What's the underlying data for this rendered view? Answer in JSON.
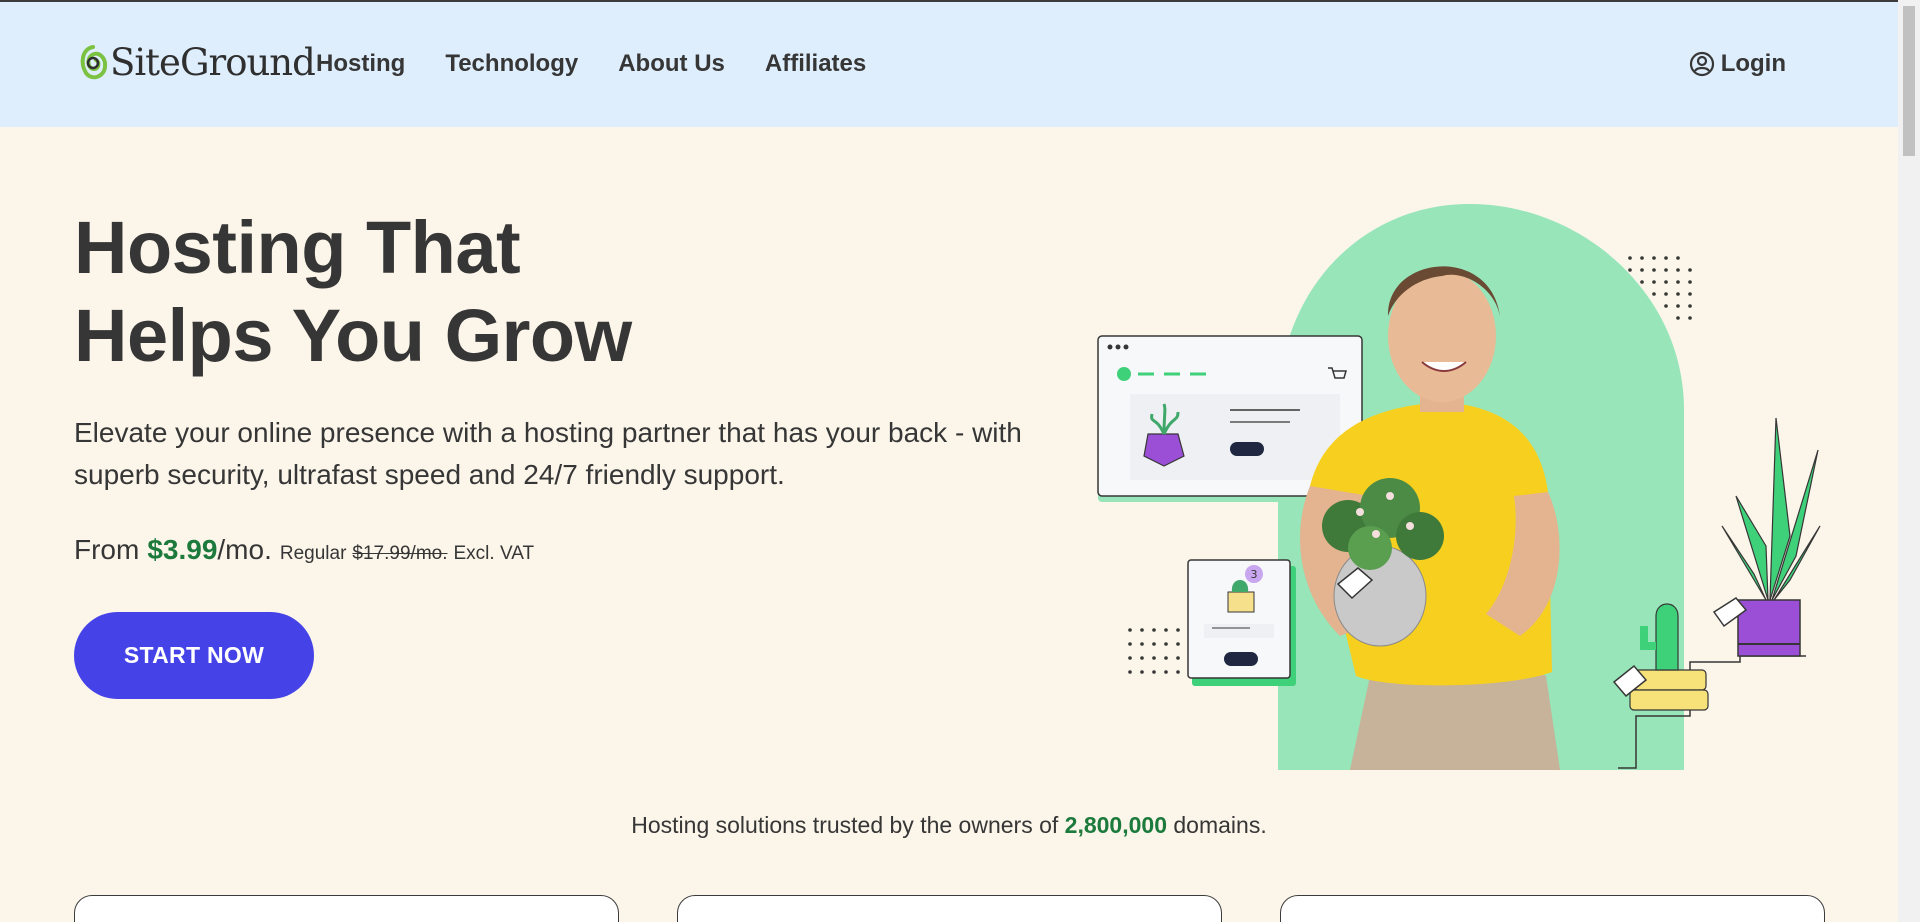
{
  "header": {
    "logo_text": "SiteGround",
    "nav": [
      "Hosting",
      "Technology",
      "About Us",
      "Affiliates"
    ],
    "login_label": "Login"
  },
  "hero": {
    "title_line1": "Hosting That",
    "title_line2": "Helps You Grow",
    "subtitle": "Elevate your online presence with a hosting partner that has your back - with superb security, ultrafast speed and 24/7 friendly support.",
    "price_from": "From",
    "price_value": "$3.99",
    "price_unit": "/mo.",
    "price_regular_label": "Regular",
    "price_regular_value": "$17.99/mo.",
    "price_vat": "Excl. VAT",
    "cta_label": "START NOW",
    "illustration_badge": "3"
  },
  "trusted": {
    "prefix": "Hosting solutions trusted by the owners of",
    "count": "2,800,000",
    "suffix": "domains."
  },
  "colors": {
    "accent": "#4543e8",
    "price_green": "#1d7a3d",
    "header_bg": "#dfeefd",
    "page_bg": "#fbf5ea",
    "mint": "#97e5b9",
    "yellow": "#f7d52b",
    "purple": "#9b4fd6"
  }
}
